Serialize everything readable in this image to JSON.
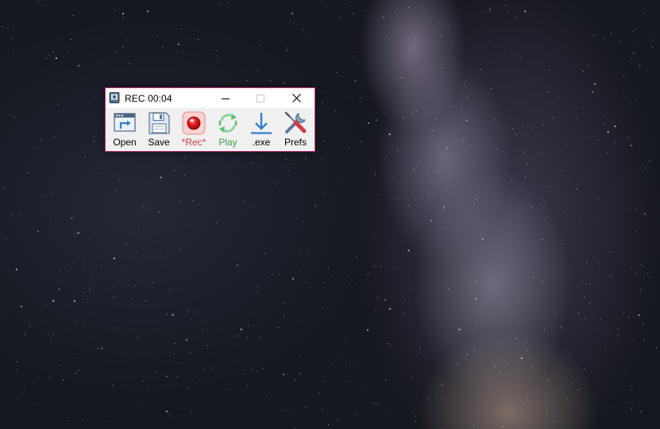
{
  "window": {
    "title": "REC 00:04",
    "border_color": "#c8327a"
  },
  "titlebar": {
    "minimize_icon": "minimize-icon",
    "maximize_icon": "maximize-icon",
    "close_icon": "close-icon"
  },
  "toolbar": {
    "items": [
      {
        "label": "Open",
        "icon": "open-folder-icon"
      },
      {
        "label": "Save",
        "icon": "floppy-disk-icon"
      },
      {
        "label": "*Rec*",
        "icon": "record-icon",
        "color": "#d23c3c"
      },
      {
        "label": "Play",
        "icon": "replay-icon",
        "color": "#3aa04a"
      },
      {
        "label": ".exe",
        "icon": "download-arrow-icon"
      },
      {
        "label": "Prefs",
        "icon": "tools-icon"
      }
    ]
  },
  "desktop": {
    "wallpaper": "milky-way-night-sky"
  }
}
